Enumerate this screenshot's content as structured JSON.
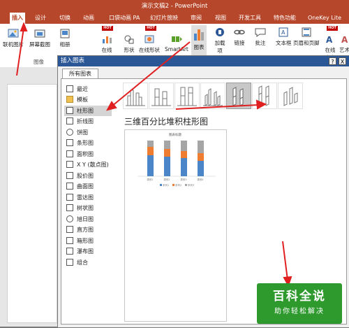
{
  "window": {
    "title": "演示文稿2 - PowerPoint"
  },
  "tabs": [
    {
      "label": "插入",
      "active": true
    },
    {
      "label": "设计"
    },
    {
      "label": "切换"
    },
    {
      "label": "动画"
    },
    {
      "label": "口袋动画 PA"
    },
    {
      "label": "幻灯片放映"
    },
    {
      "label": "审阅"
    },
    {
      "label": "视图"
    },
    {
      "label": "开发工具"
    },
    {
      "label": "特色功能"
    },
    {
      "label": "OneKey Lite"
    }
  ],
  "ribbon": {
    "buttons": [
      {
        "label": "联机图片",
        "icon": "online-picture-icon"
      },
      {
        "label": "屏幕截图",
        "icon": "screenshot-icon"
      },
      {
        "label": "相册",
        "icon": "album-icon"
      },
      {
        "label": "在线",
        "label2": "图表",
        "icon": "online-chart-icon",
        "hot": true
      },
      {
        "label": "形状",
        "icon": "shapes-icon"
      },
      {
        "label": "在线形状",
        "icon": "online-shapes-icon",
        "hot": true
      },
      {
        "label": "SmartArt",
        "icon": "smartart-icon"
      },
      {
        "label": "图表",
        "icon": "chart-icon"
      },
      {
        "label": "加载",
        "label2": "项",
        "icon": "addin-icon"
      },
      {
        "label": "链接",
        "icon": "link-icon"
      },
      {
        "label": "批注",
        "icon": "comment-icon"
      },
      {
        "label": "文本框",
        "icon": "textbox-icon"
      },
      {
        "label": "页眉和页脚",
        "icon": "header-footer-icon"
      },
      {
        "label": "在线",
        "label2": "文字",
        "icon": "online-text-icon",
        "hot": true
      },
      {
        "label": "艺术",
        "icon": "wordart-icon"
      }
    ],
    "hot_label": "HOT",
    "group_label": "图像"
  },
  "dialog": {
    "title": "插入图表",
    "help_label": "?",
    "close_label": "X",
    "tab_label": "所有图表",
    "categories": [
      {
        "label": "最近"
      },
      {
        "label": "模板"
      },
      {
        "label": "柱形图",
        "selected": true
      },
      {
        "label": "折线图"
      },
      {
        "label": "饼图"
      },
      {
        "label": "条形图"
      },
      {
        "label": "面积图"
      },
      {
        "label": "X Y (散点图)"
      },
      {
        "label": "股价图"
      },
      {
        "label": "曲面图"
      },
      {
        "label": "雷达图"
      },
      {
        "label": "树状图"
      },
      {
        "label": "旭日图"
      },
      {
        "label": "直方图"
      },
      {
        "label": "箱形图"
      },
      {
        "label": "瀑布图"
      },
      {
        "label": "组合"
      }
    ],
    "selected_type_index": 4,
    "selected_type_name": "三维百分比堆积柱形图",
    "preview_title": "图表标题",
    "preview_legend": [
      "系列1",
      "系列2",
      "系列3"
    ],
    "preview_categories": [
      "类别1",
      "类别2",
      "类别3",
      "类别4"
    ]
  },
  "watermark": {
    "line1": "百科全说",
    "line2": "助你轻松解决"
  },
  "colors": {
    "accent": "#b7472a",
    "dialog_title": "#2b5797",
    "annotation": "#e02020",
    "series1": "#4a86c8",
    "series2": "#ee7d31",
    "series3": "#a5a5a5"
  }
}
